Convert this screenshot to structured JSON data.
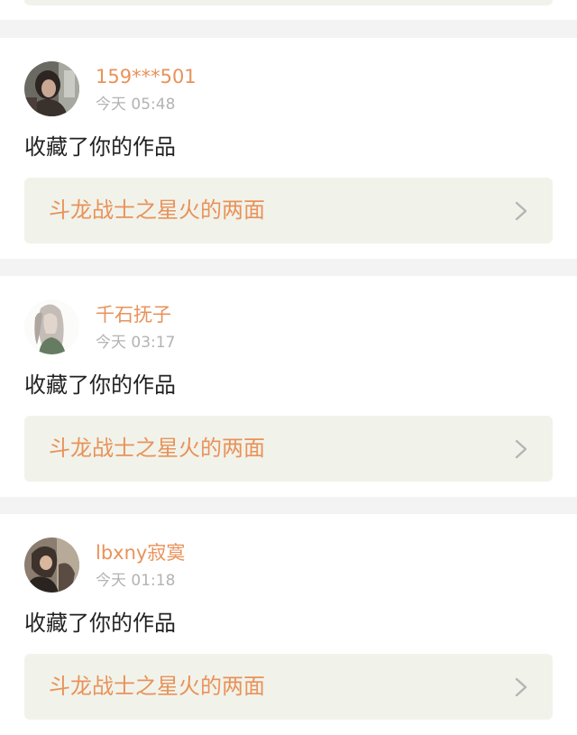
{
  "notifications": [
    {
      "username": "159***501",
      "time": "今天 05:48",
      "action": "收藏了你的作品",
      "work_title": "斗龙战士之星火的两面",
      "avatar_icon": "user-avatar-icon",
      "chevron_icon": "chevron-right-icon"
    },
    {
      "username": "千石抚子",
      "time": "今天 03:17",
      "action": "收藏了你的作品",
      "work_title": "斗龙战士之星火的两面",
      "avatar_icon": "user-avatar-icon",
      "chevron_icon": "chevron-right-icon"
    },
    {
      "username": "lbxny寂寞",
      "time": "今天 01:18",
      "action": "收藏了你的作品",
      "work_title": "斗龙战士之星火的两面",
      "avatar_icon": "user-avatar-icon",
      "chevron_icon": "chevron-right-icon"
    }
  ],
  "colors": {
    "accent_orange": "#e9925a",
    "work_link_bg": "#f1f3ea",
    "page_bg": "#f3f3f3",
    "time_gray": "#b3b3b3",
    "text_dark": "#222222"
  }
}
